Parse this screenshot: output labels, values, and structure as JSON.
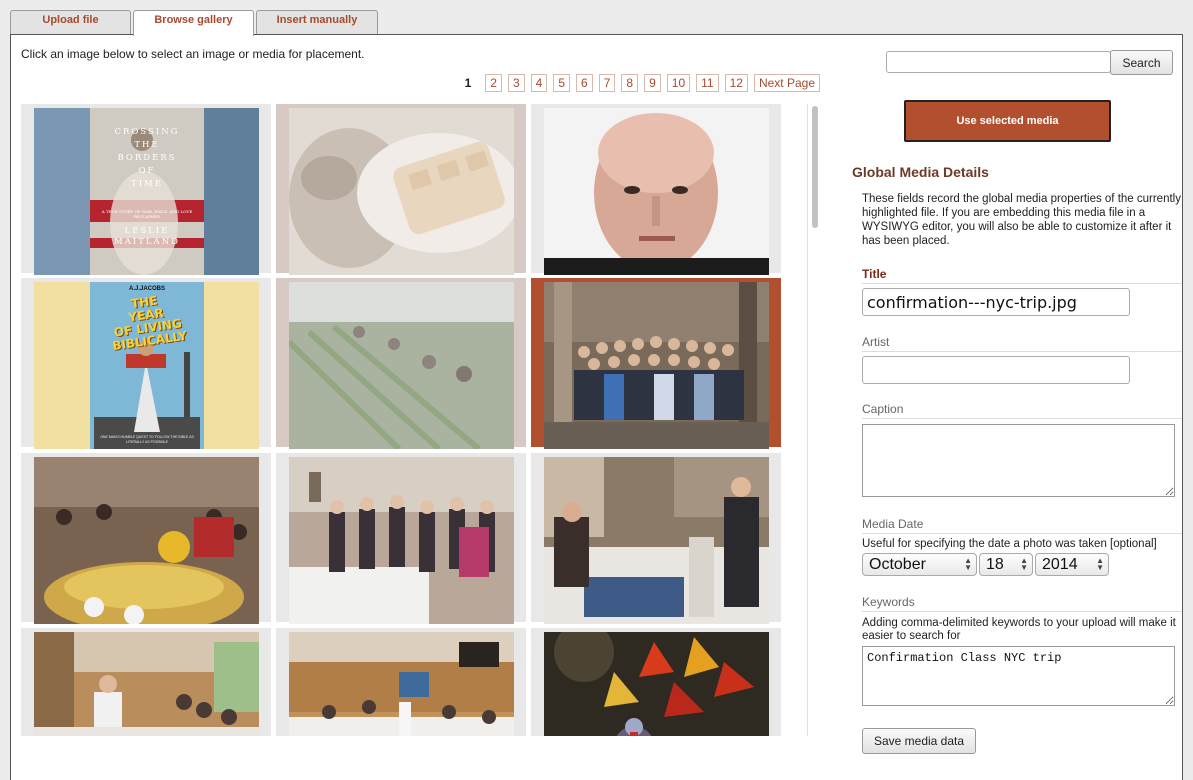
{
  "tabs": [
    "Upload file",
    "Browse gallery",
    "Insert manually"
  ],
  "intro": "Click an image below to select an image or media for placement.",
  "pagination": {
    "current": "1",
    "pages": [
      "2",
      "3",
      "4",
      "5",
      "6",
      "7",
      "8",
      "9",
      "10",
      "11",
      "12"
    ],
    "next": "Next Page"
  },
  "search": {
    "button": "Search",
    "value": ""
  },
  "use_selected": "Use selected media",
  "details": {
    "heading": "Global Media Details",
    "description": "These fields record the global media properties of the currently highlighted file. If you are embedding this media file in a WYSIWYG editor, you will also be able to customize it after it has been placed.",
    "title_label": "Title",
    "title_value": "confirmation---nyc-trip.jpg",
    "artist_label": "Artist",
    "artist_value": "",
    "caption_label": "Caption",
    "caption_value": "",
    "media_date_label": "Media Date",
    "media_date_hint": "Useful for specifying the date a photo was taken [optional]",
    "month": "October",
    "day": "18",
    "year": "2014",
    "keywords_label": "Keywords",
    "keywords_hint": "Adding comma-delimited keywords to your upload will make it easier to search for",
    "keywords_value": "Confirmation Class NYC trip",
    "save": "Save media data"
  },
  "gallery": {
    "book1": {
      "title_lines": [
        "CROSSING",
        "THE",
        "BORDERS",
        "OF",
        "TIME"
      ],
      "blurb": "A TRUE STORY OF WAR, EXILE, AND LOVE RECLAIMED",
      "author": "LESLIE MAITLAND"
    },
    "book2": {
      "author": "A.J.JACOBS",
      "title_lines": [
        "THE",
        "YEAR",
        "OF LIVING",
        "BIBLICALLY"
      ],
      "blurb": "ONE MAN'S HUMBLE QUEST TO FOLLOW THE BIBLE AS LITERALLY AS POSSIBLE"
    }
  },
  "colors": {
    "accent": "#b24f2e",
    "heading": "#6b3a28"
  }
}
